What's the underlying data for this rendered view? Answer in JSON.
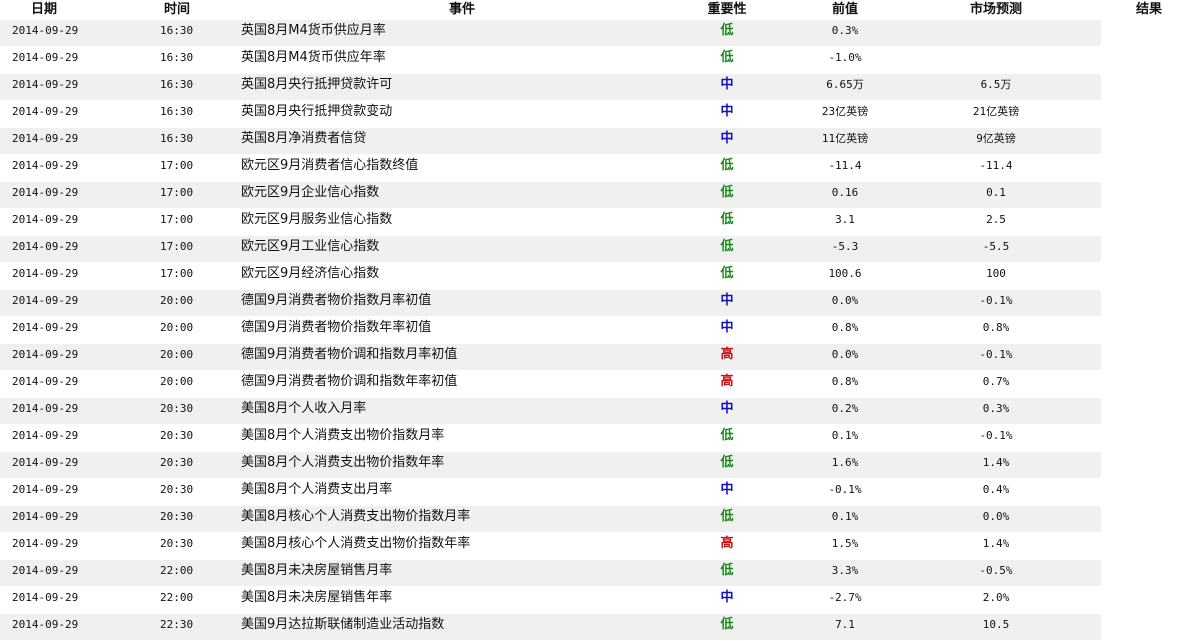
{
  "colors": {
    "row_stripe": "#f0f0f0",
    "importance_low": "#1a8a1a",
    "importance_mid": "#1010c0",
    "importance_high": "#c81010"
  },
  "table": {
    "headers": {
      "date": "日期",
      "time": "时间",
      "event": "事件",
      "importance": "重要性",
      "previous": "前值",
      "forecast": "市场预测",
      "result": "结果"
    },
    "rows": [
      {
        "date": "2014-09-29",
        "time": "16:30",
        "event": "英国8月M4货币供应月率",
        "importance": "低",
        "level": "low",
        "previous": "0.3%",
        "forecast": ""
      },
      {
        "date": "2014-09-29",
        "time": "16:30",
        "event": "英国8月M4货币供应年率",
        "importance": "低",
        "level": "low",
        "previous": "-1.0%",
        "forecast": ""
      },
      {
        "date": "2014-09-29",
        "time": "16:30",
        "event": "英国8月央行抵押贷款许可",
        "importance": "中",
        "level": "mid",
        "previous": "6.65万",
        "forecast": "6.5万"
      },
      {
        "date": "2014-09-29",
        "time": "16:30",
        "event": "英国8月央行抵押贷款变动",
        "importance": "中",
        "level": "mid",
        "previous": "23亿英镑",
        "forecast": "21亿英镑"
      },
      {
        "date": "2014-09-29",
        "time": "16:30",
        "event": "英国8月净消费者信贷",
        "importance": "中",
        "level": "mid",
        "previous": "11亿英镑",
        "forecast": "9亿英镑"
      },
      {
        "date": "2014-09-29",
        "time": "17:00",
        "event": "欧元区9月消费者信心指数终值",
        "importance": "低",
        "level": "low",
        "previous": "-11.4",
        "forecast": "-11.4"
      },
      {
        "date": "2014-09-29",
        "time": "17:00",
        "event": "欧元区9月企业信心指数",
        "importance": "低",
        "level": "low",
        "previous": "0.16",
        "forecast": "0.1"
      },
      {
        "date": "2014-09-29",
        "time": "17:00",
        "event": "欧元区9月服务业信心指数",
        "importance": "低",
        "level": "low",
        "previous": "3.1",
        "forecast": "2.5"
      },
      {
        "date": "2014-09-29",
        "time": "17:00",
        "event": "欧元区9月工业信心指数",
        "importance": "低",
        "level": "low",
        "previous": "-5.3",
        "forecast": "-5.5"
      },
      {
        "date": "2014-09-29",
        "time": "17:00",
        "event": "欧元区9月经济信心指数",
        "importance": "低",
        "level": "low",
        "previous": "100.6",
        "forecast": "100"
      },
      {
        "date": "2014-09-29",
        "time": "20:00",
        "event": "德国9月消费者物价指数月率初值",
        "importance": "中",
        "level": "mid",
        "previous": "0.0%",
        "forecast": "-0.1%"
      },
      {
        "date": "2014-09-29",
        "time": "20:00",
        "event": "德国9月消费者物价指数年率初值",
        "importance": "中",
        "level": "mid",
        "previous": "0.8%",
        "forecast": "0.8%"
      },
      {
        "date": "2014-09-29",
        "time": "20:00",
        "event": "德国9月消费者物价调和指数月率初值",
        "importance": "高",
        "level": "high",
        "previous": "0.0%",
        "forecast": "-0.1%"
      },
      {
        "date": "2014-09-29",
        "time": "20:00",
        "event": "德国9月消费者物价调和指数年率初值",
        "importance": "高",
        "level": "high",
        "previous": "0.8%",
        "forecast": "0.7%"
      },
      {
        "date": "2014-09-29",
        "time": "20:30",
        "event": "美国8月个人收入月率",
        "importance": "中",
        "level": "mid",
        "previous": "0.2%",
        "forecast": "0.3%"
      },
      {
        "date": "2014-09-29",
        "time": "20:30",
        "event": "美国8月个人消费支出物价指数月率",
        "importance": "低",
        "level": "low",
        "previous": "0.1%",
        "forecast": "-0.1%"
      },
      {
        "date": "2014-09-29",
        "time": "20:30",
        "event": "美国8月个人消费支出物价指数年率",
        "importance": "低",
        "level": "low",
        "previous": "1.6%",
        "forecast": "1.4%"
      },
      {
        "date": "2014-09-29",
        "time": "20:30",
        "event": "美国8月个人消费支出月率",
        "importance": "中",
        "level": "mid",
        "previous": "-0.1%",
        "forecast": "0.4%"
      },
      {
        "date": "2014-09-29",
        "time": "20:30",
        "event": "美国8月核心个人消费支出物价指数月率",
        "importance": "低",
        "level": "low",
        "previous": "0.1%",
        "forecast": "0.0%"
      },
      {
        "date": "2014-09-29",
        "time": "20:30",
        "event": "美国8月核心个人消费支出物价指数年率",
        "importance": "高",
        "level": "high",
        "previous": "1.5%",
        "forecast": "1.4%"
      },
      {
        "date": "2014-09-29",
        "time": "22:00",
        "event": "美国8月未决房屋销售月率",
        "importance": "低",
        "level": "low",
        "previous": "3.3%",
        "forecast": "-0.5%"
      },
      {
        "date": "2014-09-29",
        "time": "22:00",
        "event": "美国8月未决房屋销售年率",
        "importance": "中",
        "level": "mid",
        "previous": "-2.7%",
        "forecast": "2.0%"
      },
      {
        "date": "2014-09-29",
        "time": "22:30",
        "event": "美国9月达拉斯联储制造业活动指数",
        "importance": "低",
        "level": "low",
        "previous": "7.1",
        "forecast": "10.5"
      }
    ]
  }
}
